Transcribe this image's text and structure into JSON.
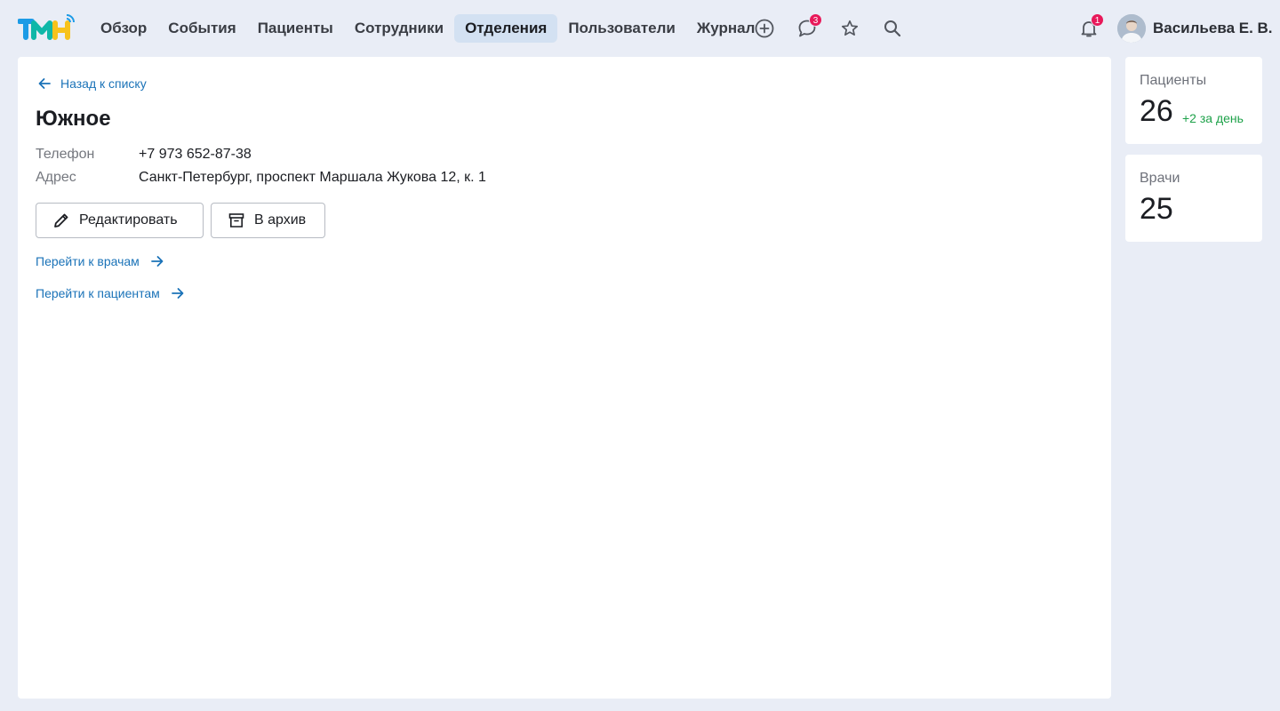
{
  "nav": {
    "items": [
      {
        "label": "Обзор"
      },
      {
        "label": "События"
      },
      {
        "label": "Пациенты"
      },
      {
        "label": "Сотрудники"
      },
      {
        "label": "Отделения",
        "active": true
      },
      {
        "label": "Пользователи"
      },
      {
        "label": "Журнал"
      }
    ],
    "messages_badge": "3",
    "notifications_badge": "1"
  },
  "user": {
    "name": "Васильева Е. В."
  },
  "department": {
    "back_label": "Назад к списку",
    "title": "Южное",
    "phone_label": "Телефон",
    "phone_value": "+7 973 652-87-38",
    "address_label": "Адрес",
    "address_value": "Санкт-Петербург, проспект Маршала Жукова 12, к. 1",
    "edit_label": "Редактировать",
    "archive_label": "В архив",
    "go_doctors_label": "Перейти к врачам",
    "go_patients_label": "Перейти к пациентам"
  },
  "stats": {
    "patients": {
      "label": "Пациенты",
      "value": "26",
      "delta": "+2 за день"
    },
    "doctors": {
      "label": "Врачи",
      "value": "25"
    }
  },
  "colors": {
    "link": "#1b73b8",
    "badge": "#e8195a",
    "positive": "#1ea24a",
    "active_nav": "#d3e1f2",
    "background": "#e9edf6"
  }
}
